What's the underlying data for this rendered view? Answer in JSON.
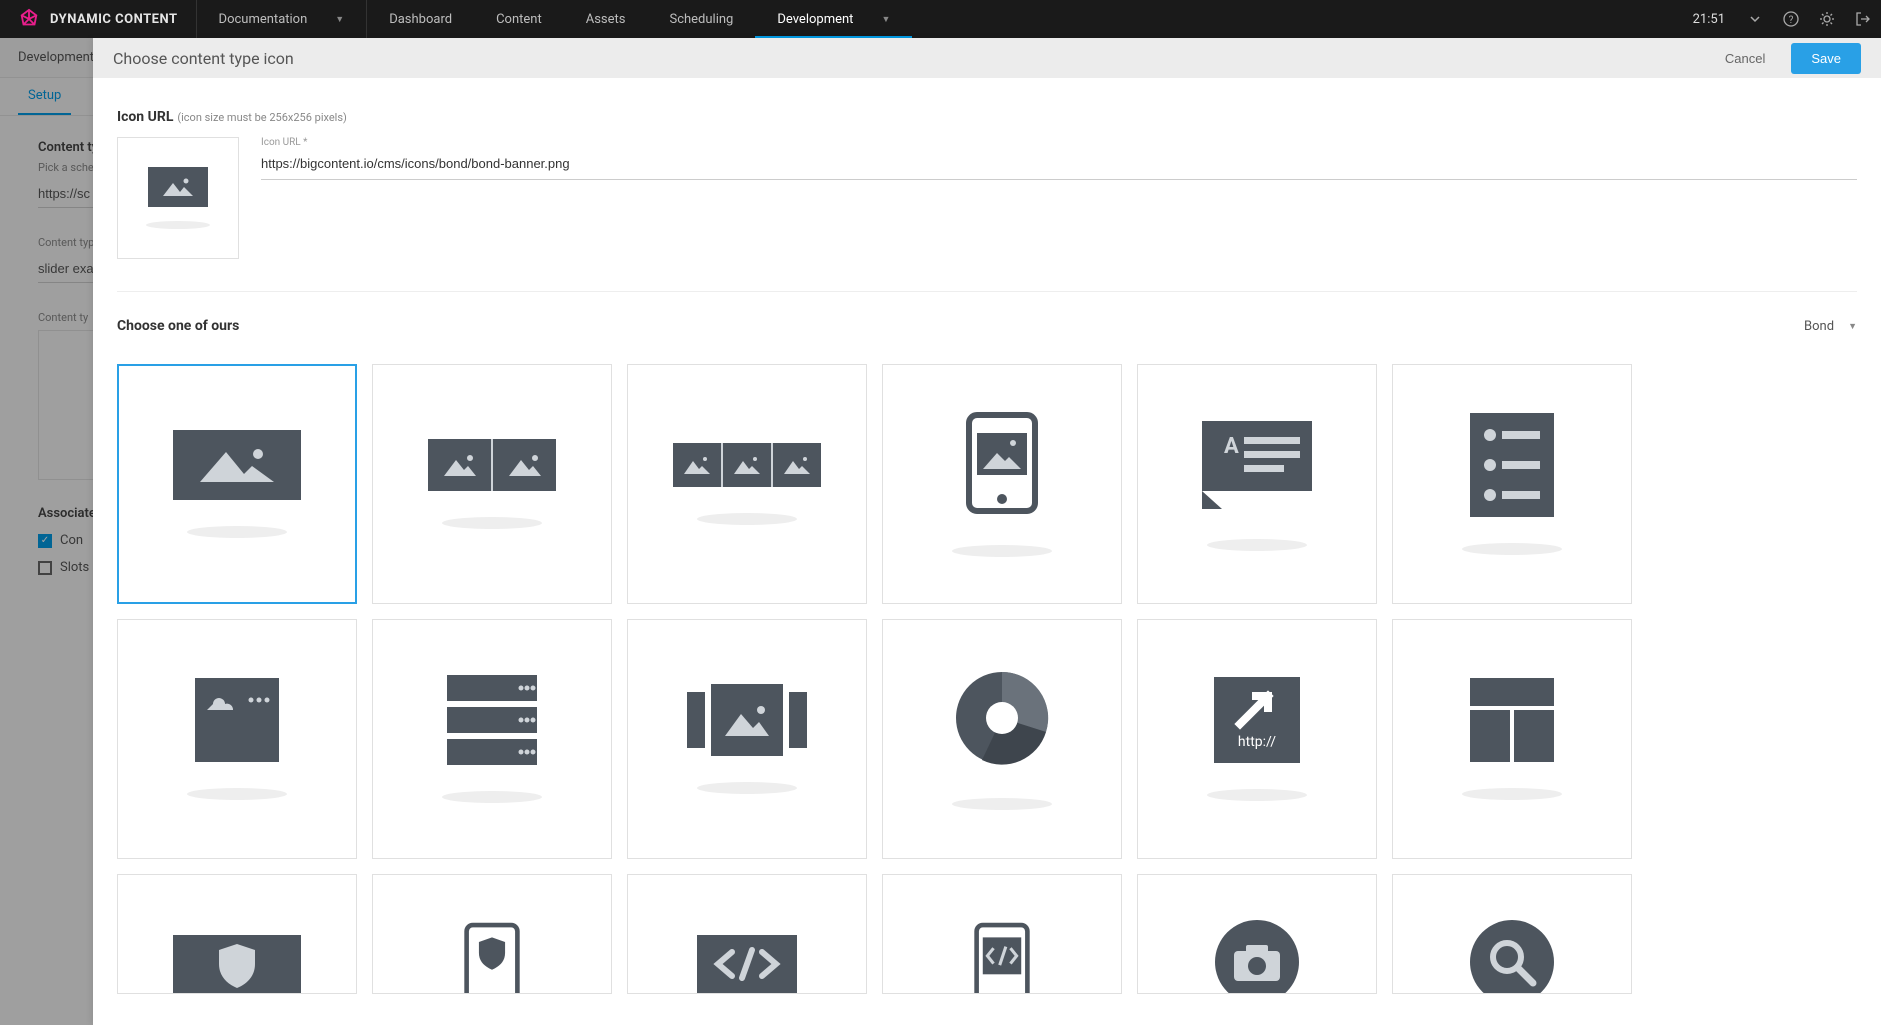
{
  "brand": {
    "name": "DYNAMIC CONTENT"
  },
  "topnav": {
    "documentation": "Documentation",
    "dashboard": "Dashboard",
    "content": "Content",
    "assets": "Assets",
    "scheduling": "Scheduling",
    "development": "Development"
  },
  "time": "21:51",
  "background": {
    "breadcrumb": "Development",
    "tab_setup": "Setup",
    "content_type_label": "Content ty",
    "schema_pick_label": "Pick a schem",
    "schema_value": "https://sc",
    "content_type_small": "Content type",
    "slider_value": "slider exa",
    "content_type_small2": "Content ty",
    "assoc_title": "Associate",
    "check_content": "Con",
    "check_slots": "Slots"
  },
  "modal": {
    "title": "Choose content type icon",
    "cancel": "Cancel",
    "save": "Save",
    "icon_url_title": "Icon URL",
    "icon_url_hint": "(icon size must be 256x256 pixels)",
    "icon_url_field_label": "Icon URL *",
    "icon_url_value": "https://bigcontent.io/cms/icons/bond/bond-banner.png",
    "choose_title": "Choose one of ours",
    "filter_label": "Bond",
    "icons": [
      "banner",
      "split-2",
      "split-3",
      "mobile-banner",
      "author-card",
      "contact-list",
      "card-cloud",
      "server-list",
      "carousel",
      "donut-chart",
      "external-link",
      "layout-grid",
      "banner-shield",
      "mobile-shield",
      "code-block",
      "mobile-code",
      "camera-circle",
      "search-circle"
    ]
  }
}
